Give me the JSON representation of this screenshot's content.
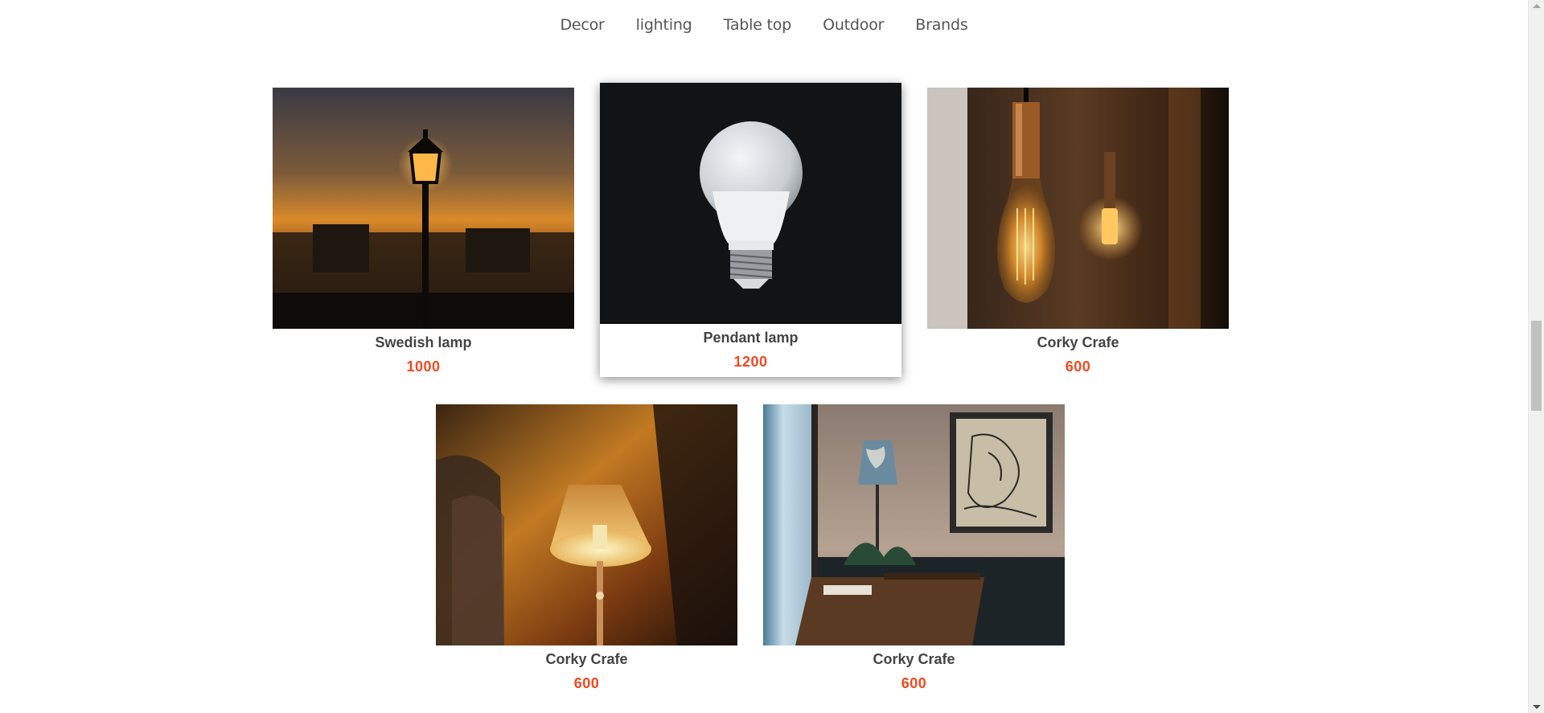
{
  "nav": {
    "items": [
      "Decor",
      "lighting",
      "Table top",
      "Outdoor",
      "Brands"
    ]
  },
  "products": [
    {
      "name": "Swedish lamp",
      "price": "1000",
      "image": "street-lamp-sunset-image"
    },
    {
      "name": "Pendant lamp",
      "price": "1200",
      "image": "light-bulb-image",
      "highlighted": true
    },
    {
      "name": "Corky Crafe",
      "price": "600",
      "image": "edison-bulbs-image"
    },
    {
      "name": "Corky Crafe",
      "price": "600",
      "image": "table-lamp-warm-image"
    },
    {
      "name": "Corky Crafe",
      "price": "600",
      "image": "window-desk-lamp-image"
    }
  ],
  "colors": {
    "price": "#f4481f",
    "name": "#444444",
    "nav_text": "#555555"
  }
}
